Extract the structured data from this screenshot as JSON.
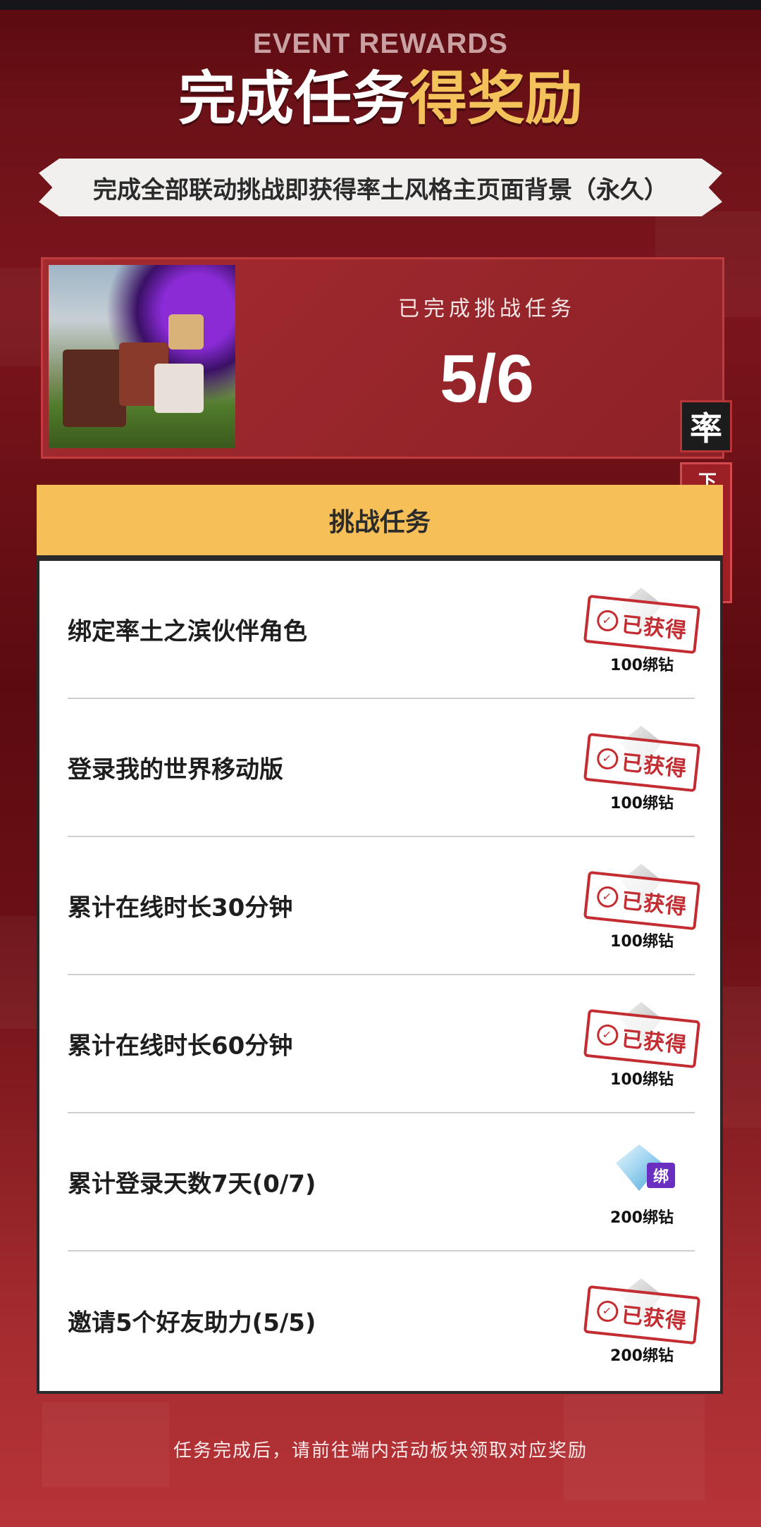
{
  "header": {
    "event_label": "EVENT REWARDS",
    "title_white": "完成任务",
    "title_gold": "得奖励",
    "banner_text": "完成全部联动挑战即获得率土风格主页面背景（永久）"
  },
  "progress": {
    "label": "已完成挑战任务",
    "completed": 5,
    "total": 6,
    "count_text": "5/6"
  },
  "side": {
    "game_icon_char": "率",
    "download_label": "下载游戏",
    "download_arrow": "↓"
  },
  "tasks": {
    "header": "挑战任务",
    "items": [
      {
        "name": "绑定率土之滨伙伴角色",
        "reward": "100绑钻",
        "stamp": "已获得",
        "claimed": true
      },
      {
        "name": "登录我的世界移动版",
        "reward": "100绑钻",
        "stamp": "已获得",
        "claimed": true
      },
      {
        "name": "累计在线时长30分钟",
        "reward": "100绑钻",
        "stamp": "已获得",
        "claimed": true
      },
      {
        "name": "累计在线时长60分钟",
        "reward": "100绑钻",
        "stamp": "已获得",
        "claimed": true
      },
      {
        "name": "累计登录天数7天(0/7)",
        "reward": "200绑钻",
        "bind_tag": "绑",
        "claimed": false
      },
      {
        "name": "邀请5个好友助力(5/5)",
        "reward": "200绑钻",
        "stamp": "已获得",
        "claimed": true
      }
    ]
  },
  "footer": {
    "note": "任务完成后，请前往端内活动板块领取对应奖励"
  },
  "colors": {
    "background": "#6d1218",
    "gold": "#f3c25a",
    "stamp_red": "#c32d32",
    "tasks_header": "#f6bf57"
  }
}
